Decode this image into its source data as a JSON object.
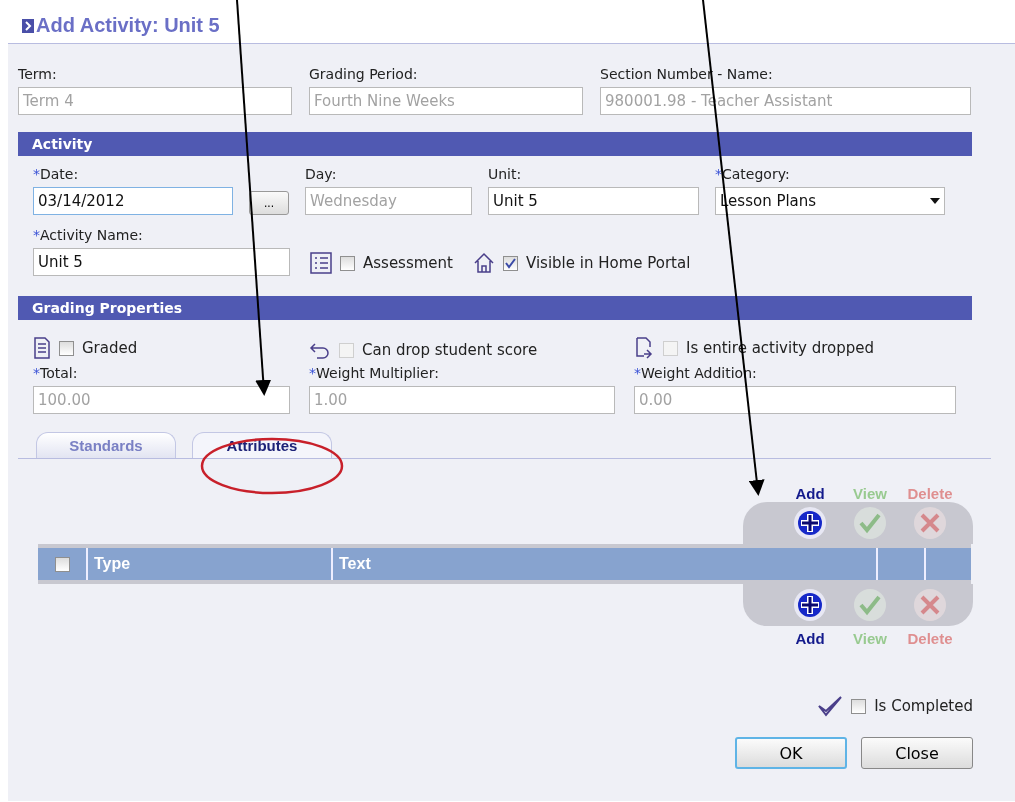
{
  "title": "Add Activity: Unit 5",
  "top_fields": [
    {
      "label": "Term:",
      "value": "Term 4",
      "disabled": true
    },
    {
      "label": "Grading Period:",
      "value": "Fourth Nine Weeks",
      "disabled": true
    },
    {
      "label": "Section Number - Name:",
      "value": "980001.98 - Teacher Assistant",
      "disabled": true
    }
  ],
  "activity": {
    "title": "Activity",
    "date": {
      "marker": "*",
      "label": "Date:",
      "value": "03/14/2012",
      "picker": "..."
    },
    "day": {
      "label": "Day:",
      "value": "Wednesday",
      "disabled": true
    },
    "unit": {
      "label": "Unit:",
      "value": "Unit 5",
      "disabled": false
    },
    "category": {
      "marker": "*",
      "label": "Category:",
      "value": "Lesson Plans"
    },
    "name": {
      "marker": "*",
      "label": "Activity Name:",
      "value": "Unit 5"
    },
    "options": [
      {
        "kind": "list",
        "label": "Assessment",
        "checked": false,
        "disabled": false
      },
      {
        "kind": "home",
        "label": "Visible in Home Portal",
        "checked": true,
        "disabled": false
      }
    ]
  },
  "grading": {
    "title": "Grading Properties",
    "options": [
      {
        "kind": "page",
        "label": "Graded",
        "checked": false,
        "disabled": false
      },
      {
        "kind": "undo",
        "label": "Can drop student score",
        "checked": false,
        "disabled": true
      },
      {
        "kind": "doc",
        "label": "Is entire activity dropped",
        "checked": false,
        "disabled": true
      }
    ],
    "fields": [
      {
        "marker": "*",
        "label": "Total:",
        "value": "100.00",
        "disabled": true
      },
      {
        "marker": "*",
        "label": "Weight Multiplier:",
        "value": "1.00",
        "disabled": true
      },
      {
        "marker": "*",
        "label": "Weight Addition:",
        "value": "0.00",
        "disabled": true
      }
    ]
  },
  "tabs": [
    {
      "label": "Standards",
      "selected": false
    },
    {
      "label": "Attributes",
      "selected": true
    }
  ],
  "top_actions": [
    {
      "kind": "add",
      "label": "Add",
      "disabled": false
    },
    {
      "kind": "view",
      "label": "View",
      "disabled": true
    },
    {
      "kind": "delete",
      "label": "Delete",
      "disabled": true
    }
  ],
  "table": {
    "select_all": {
      "checked": false
    },
    "columns": [
      "Type",
      "Text"
    ]
  },
  "bottom_actions": [
    {
      "kind": "add",
      "label": "Add",
      "disabled": false
    },
    {
      "kind": "view",
      "label": "View",
      "disabled": true
    },
    {
      "kind": "delete",
      "label": "Delete",
      "disabled": true
    }
  ],
  "completed": {
    "label": "Is Completed",
    "checked": false
  },
  "buttons": [
    {
      "label": "OK",
      "focused": true
    },
    {
      "label": "Close",
      "focused": false
    }
  ]
}
